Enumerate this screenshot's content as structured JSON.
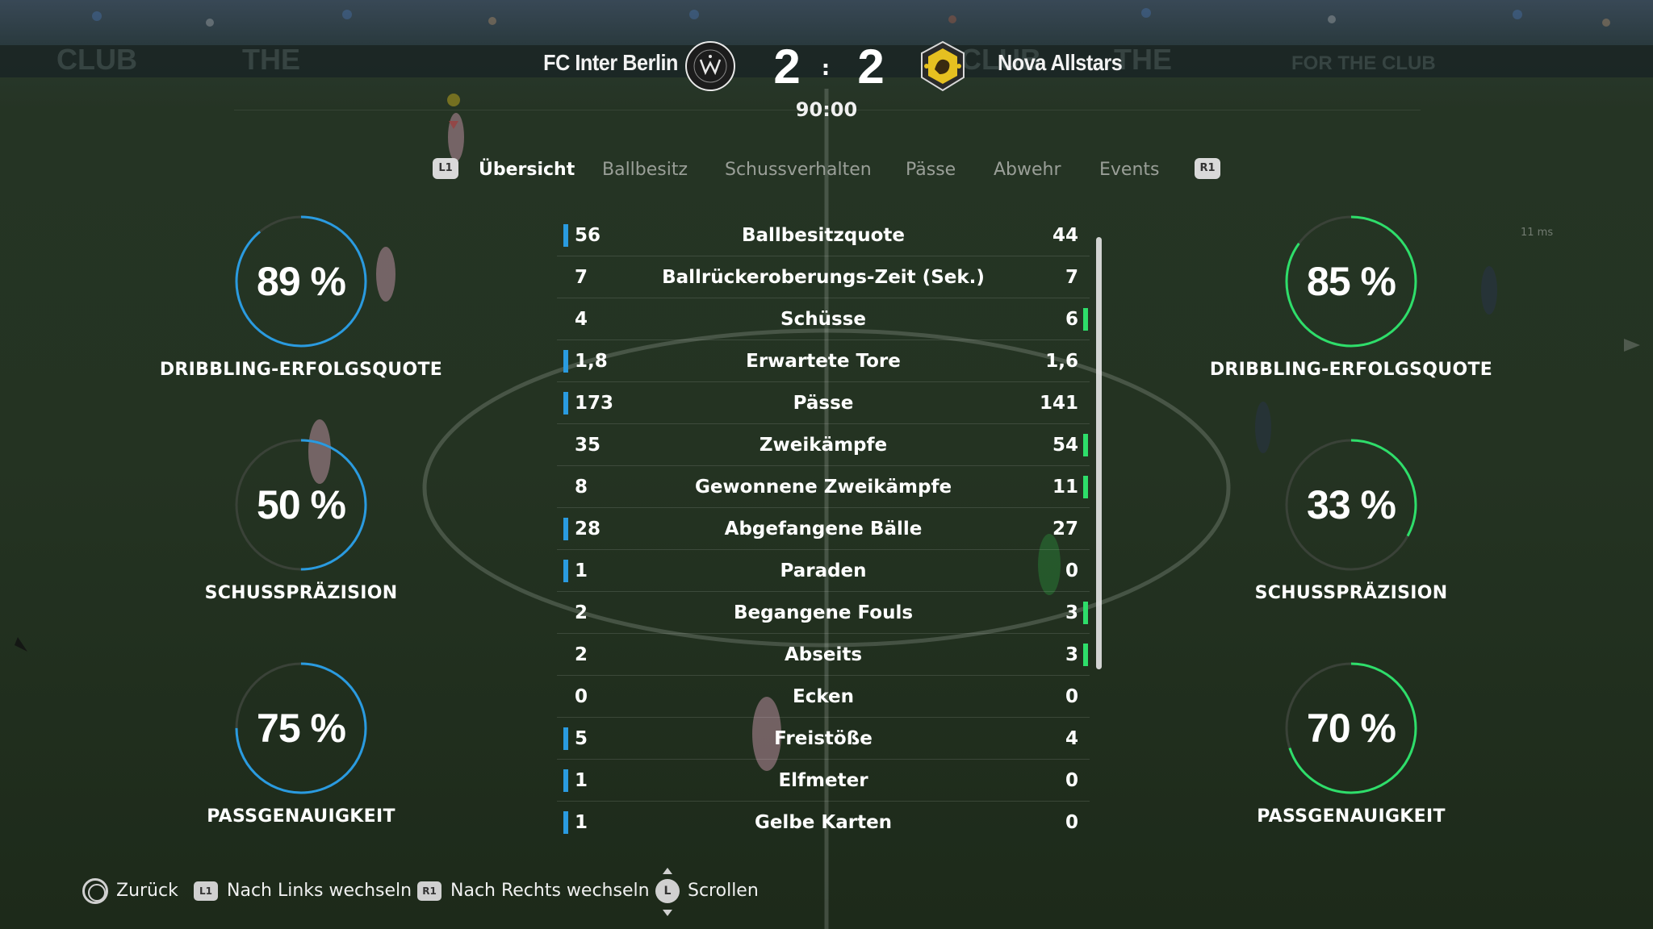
{
  "match": {
    "home_team": "FC Inter Berlin",
    "away_team": "Nova Allstars",
    "home_score": "2",
    "separator": ":",
    "away_score": "2",
    "time": "90:00",
    "home_crest_icon": "miami-crest-icon",
    "away_crest_icon": "gold-lion-crest-icon"
  },
  "tabs": {
    "left_button": "L1",
    "right_button": "R1",
    "items": [
      "Übersicht",
      "Ballbesitz",
      "Schussverhalten",
      "Pässe",
      "Abwehr",
      "Events"
    ],
    "active": 0
  },
  "gauges": {
    "home": [
      {
        "value": "89 %",
        "label": "DRIBBLING-ERFOLGSQUOTE",
        "percent": 89
      },
      {
        "value": "50 %",
        "label": "SCHUSSPRÄZISION",
        "percent": 50
      },
      {
        "value": "75 %",
        "label": "PASSGENAUIGKEIT",
        "percent": 75
      }
    ],
    "away": [
      {
        "value": "85 %",
        "label": "DRIBBLING-ERFOLGSQUOTE",
        "percent": 85
      },
      {
        "value": "33 %",
        "label": "SCHUSSPRÄZISION",
        "percent": 33
      },
      {
        "value": "70 %",
        "label": "PASSGENAUIGKEIT",
        "percent": 70
      }
    ]
  },
  "stats": [
    {
      "label": "Ballbesitzquote",
      "home": "56",
      "away": "44",
      "leader": "home"
    },
    {
      "label": "Ballrückeroberungs-Zeit (Sek.)",
      "home": "7",
      "away": "7",
      "leader": "none"
    },
    {
      "label": "Schüsse",
      "home": "4",
      "away": "6",
      "leader": "away"
    },
    {
      "label": "Erwartete Tore",
      "home": "1,8",
      "away": "1,6",
      "leader": "home"
    },
    {
      "label": "Pässe",
      "home": "173",
      "away": "141",
      "leader": "home"
    },
    {
      "label": "Zweikämpfe",
      "home": "35",
      "away": "54",
      "leader": "away"
    },
    {
      "label": "Gewonnene Zweikämpfe",
      "home": "8",
      "away": "11",
      "leader": "away"
    },
    {
      "label": "Abgefangene Bälle",
      "home": "28",
      "away": "27",
      "leader": "home"
    },
    {
      "label": "Paraden",
      "home": "1",
      "away": "0",
      "leader": "home"
    },
    {
      "label": "Begangene Fouls",
      "home": "2",
      "away": "3",
      "leader": "away"
    },
    {
      "label": "Abseits",
      "home": "2",
      "away": "3",
      "leader": "away"
    },
    {
      "label": "Ecken",
      "home": "0",
      "away": "0",
      "leader": "none"
    },
    {
      "label": "Freistöße",
      "home": "5",
      "away": "4",
      "leader": "home"
    },
    {
      "label": "Elfmeter",
      "home": "1",
      "away": "0",
      "leader": "home"
    },
    {
      "label": "Gelbe Karten",
      "home": "1",
      "away": "0",
      "leader": "home"
    }
  ],
  "latency": "11 ms",
  "colors": {
    "home_accent": "#2a9be0",
    "away_accent": "#2ede6a",
    "gauge_track": "#3a4238"
  },
  "footer": {
    "back": {
      "button": "circle-button-icon",
      "label": "Zurück"
    },
    "left": {
      "button": "L1",
      "label": "Nach Links wechseln"
    },
    "right": {
      "button": "R1",
      "label": "Nach Rechts wechseln"
    },
    "scroll": {
      "button": "L",
      "label": "Scrollen"
    }
  }
}
